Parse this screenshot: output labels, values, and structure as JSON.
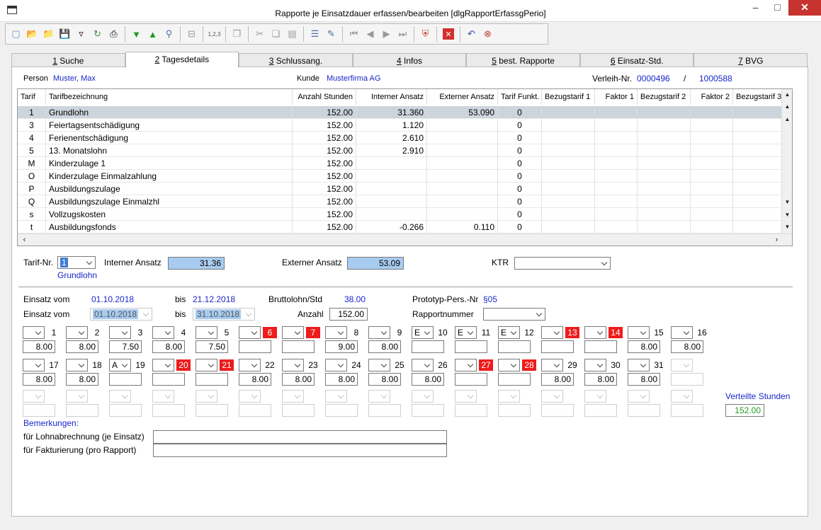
{
  "window": {
    "title": "Rapporte je Einsatzdauer erfassen/bearbeiten [dlgRapportErfassgPerio]"
  },
  "tabs": [
    {
      "key": "1",
      "label": " Suche"
    },
    {
      "key": "2",
      "label": " Tagesdetails"
    },
    {
      "key": "3",
      "label": " Schlussang."
    },
    {
      "key": "4",
      "label": " Infos"
    },
    {
      "key": "5",
      "label": " best. Rapporte"
    },
    {
      "key": "6",
      "label": " Einsatz-Std."
    },
    {
      "key": "7",
      "label": " BVG"
    }
  ],
  "header": {
    "person_label": "Person",
    "person_value": "Muster, Max",
    "kunde_label": "Kunde",
    "kunde_value": "Musterfirma AG",
    "verleih_label": "Verleih-Nr.",
    "verleih_value1": "0000496",
    "slash": "/",
    "verleih_value2": "1000588"
  },
  "grid": {
    "columns": [
      "Tarif",
      "Tarifbezeichnung",
      "Anzahl Stunden",
      "Interner Ansatz",
      "Externer Ansatz",
      "Tarif Funkt.",
      "Bezugstarif 1",
      "Faktor 1",
      "Bezugstarif 2",
      "Faktor 2",
      "Bezugstarif 3"
    ],
    "rows": [
      {
        "tarif": "1",
        "bez": "Grundlohn",
        "std": "152.00",
        "int": "31.360",
        "ext": "53.090",
        "funkt": "0"
      },
      {
        "tarif": "3",
        "bez": "Feiertagsentschädigung",
        "std": "152.00",
        "int": "1.120",
        "ext": "",
        "funkt": "0"
      },
      {
        "tarif": "4",
        "bez": "Ferienentschädigung",
        "std": "152.00",
        "int": "2.610",
        "ext": "",
        "funkt": "0"
      },
      {
        "tarif": "5",
        "bez": "13. Monatslohn",
        "std": "152.00",
        "int": "2.910",
        "ext": "",
        "funkt": "0"
      },
      {
        "tarif": "M",
        "bez": "Kinderzulage 1",
        "std": "152.00",
        "int": "",
        "ext": "",
        "funkt": "0"
      },
      {
        "tarif": "O",
        "bez": "Kinderzulage Einmalzahlung",
        "std": "152.00",
        "int": "",
        "ext": "",
        "funkt": "0"
      },
      {
        "tarif": "P",
        "bez": "Ausbildungszulage",
        "std": "152.00",
        "int": "",
        "ext": "",
        "funkt": "0"
      },
      {
        "tarif": "Q",
        "bez": "Ausbildungszulage Einmalzhl",
        "std": "152.00",
        "int": "",
        "ext": "",
        "funkt": "0"
      },
      {
        "tarif": "s",
        "bez": "Vollzugskosten",
        "std": "152.00",
        "int": "",
        "ext": "",
        "funkt": "0"
      },
      {
        "tarif": "t",
        "bez": "Ausbildungsfonds",
        "std": "152.00",
        "int": "-0.266",
        "ext": "0.110",
        "funkt": "0"
      }
    ]
  },
  "tarifform": {
    "tarif_nr_label": "Tarif-Nr.",
    "tarif_nr_value": "1",
    "tarif_name": "Grundlohn",
    "int_label": "Interner Ansatz",
    "int_value": "31.36",
    "ext_label": "Externer Ansatz",
    "ext_value": "53.09",
    "ktr_label": "KTR"
  },
  "einsatz": {
    "vom_label": "Einsatz vom",
    "vom_value": "01.10.2018",
    "bis_label": "bis",
    "bis_value": "21.12.2018",
    "brutto_label": "Bruttolohn/Std",
    "brutto_value": "38.00",
    "proto_label": "Prototyp-Pers.-Nr",
    "proto_value": "§05",
    "vom2_label": "Einsatz vom",
    "vom2_value": "01.10.2018",
    "bis2_label": "bis",
    "bis2_value": "31.10.2018",
    "anzahl_label": "Anzahl",
    "anzahl_value": "152.00",
    "rapport_label": "Rapportnummer"
  },
  "days_row1": [
    {
      "n": "1",
      "code": "",
      "h": "8.00",
      "red": false
    },
    {
      "n": "2",
      "code": "",
      "h": "8.00",
      "red": false
    },
    {
      "n": "3",
      "code": "",
      "h": "7.50",
      "red": false
    },
    {
      "n": "4",
      "code": "",
      "h": "8.00",
      "red": false
    },
    {
      "n": "5",
      "code": "",
      "h": "7.50",
      "red": false
    },
    {
      "n": "6",
      "code": "",
      "h": "",
      "red": true
    },
    {
      "n": "7",
      "code": "",
      "h": "",
      "red": true
    },
    {
      "n": "8",
      "code": "",
      "h": "9.00",
      "red": false
    },
    {
      "n": "9",
      "code": "",
      "h": "8.00",
      "red": false
    },
    {
      "n": "10",
      "code": "E",
      "h": "",
      "red": false
    },
    {
      "n": "11",
      "code": "E",
      "h": "",
      "red": false
    },
    {
      "n": "12",
      "code": "E",
      "h": "",
      "red": false
    },
    {
      "n": "13",
      "code": "",
      "h": "",
      "red": true
    },
    {
      "n": "14",
      "code": "",
      "h": "",
      "red": true
    },
    {
      "n": "15",
      "code": "",
      "h": "8.00",
      "red": false
    },
    {
      "n": "16",
      "code": "",
      "h": "8.00",
      "red": false
    }
  ],
  "days_row2": [
    {
      "n": "17",
      "code": "",
      "h": "8.00",
      "red": false
    },
    {
      "n": "18",
      "code": "",
      "h": "8.00",
      "red": false
    },
    {
      "n": "19",
      "code": "A",
      "h": "",
      "red": false
    },
    {
      "n": "20",
      "code": "",
      "h": "",
      "red": true
    },
    {
      "n": "21",
      "code": "",
      "h": "",
      "red": true
    },
    {
      "n": "22",
      "code": "",
      "h": "8.00",
      "red": false
    },
    {
      "n": "23",
      "code": "",
      "h": "8.00",
      "red": false
    },
    {
      "n": "24",
      "code": "",
      "h": "8.00",
      "red": false
    },
    {
      "n": "25",
      "code": "",
      "h": "8.00",
      "red": false
    },
    {
      "n": "26",
      "code": "",
      "h": "8.00",
      "red": false
    },
    {
      "n": "27",
      "code": "",
      "h": "",
      "red": true
    },
    {
      "n": "28",
      "code": "",
      "h": "",
      "red": true
    },
    {
      "n": "29",
      "code": "",
      "h": "8.00",
      "red": false
    },
    {
      "n": "30",
      "code": "",
      "h": "8.00",
      "red": false
    },
    {
      "n": "31",
      "code": "",
      "h": "8.00",
      "red": false
    }
  ],
  "verteilte_label": "Verteilte Stunden",
  "verteilte_value": "152.00",
  "bemerkungen": {
    "title": "Bemerkungen:",
    "lohn_label": "für Lohnabrechnung (je Einsatz)",
    "fakt_label": "für Fakturierung (pro Rapport)"
  }
}
